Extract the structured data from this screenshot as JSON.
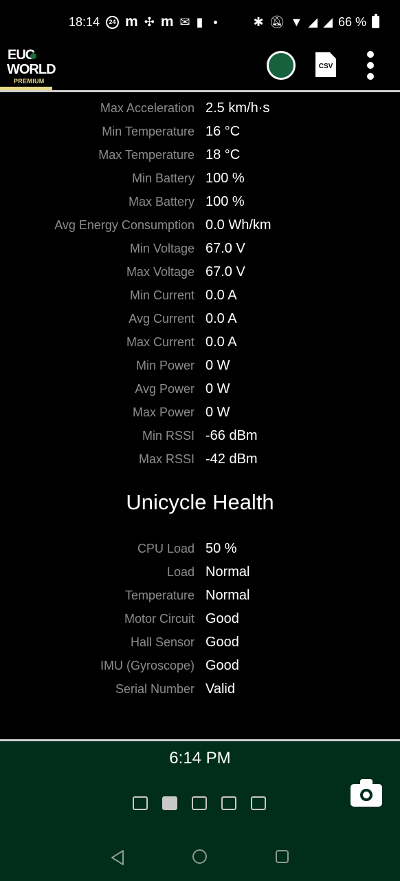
{
  "status_bar": {
    "time": "18:14",
    "circle_badge": "24",
    "battery_percent": "66 %"
  },
  "app_bar": {
    "logo_line1": "EUC",
    "logo_line2": "WORLD",
    "logo_badge": "PREMIUM",
    "status_color": "#17623c",
    "csv_label": "CSV"
  },
  "stats": [
    {
      "label": "Max Acceleration",
      "value": "2.5 km/h·s"
    },
    {
      "label": "Min Temperature",
      "value": "16 °C"
    },
    {
      "label": "Max Temperature",
      "value": "18 °C"
    },
    {
      "label": "Min Battery",
      "value": "100 %"
    },
    {
      "label": "Max Battery",
      "value": "100 %"
    },
    {
      "label": "Avg Energy Consumption",
      "value": "0.0 Wh/km"
    },
    {
      "label": "Min Voltage",
      "value": "67.0 V"
    },
    {
      "label": "Max Voltage",
      "value": "67.0 V"
    },
    {
      "label": "Min Current",
      "value": "0.0 A"
    },
    {
      "label": "Avg Current",
      "value": "0.0 A"
    },
    {
      "label": "Max Current",
      "value": "0.0 A"
    },
    {
      "label": "Min Power",
      "value": "0 W"
    },
    {
      "label": "Avg Power",
      "value": "0 W"
    },
    {
      "label": "Max Power",
      "value": "0 W"
    },
    {
      "label": "Min RSSI",
      "value": "-66 dBm"
    },
    {
      "label": "Max RSSI",
      "value": "-42 dBm"
    }
  ],
  "health": {
    "title": "Unicycle Health",
    "items": [
      {
        "label": "CPU Load",
        "value": "50 %"
      },
      {
        "label": "Load",
        "value": "Normal"
      },
      {
        "label": "Temperature",
        "value": "Normal"
      },
      {
        "label": "Motor Circuit",
        "value": "Good"
      },
      {
        "label": "Hall Sensor",
        "value": "Good"
      },
      {
        "label": "IMU (Gyroscope)",
        "value": "Good"
      },
      {
        "label": "Serial Number",
        "value": "Valid"
      }
    ]
  },
  "bottom": {
    "clock": "6:14 PM",
    "page_count": 5,
    "active_page": 2,
    "background_color": "#002e1b"
  }
}
